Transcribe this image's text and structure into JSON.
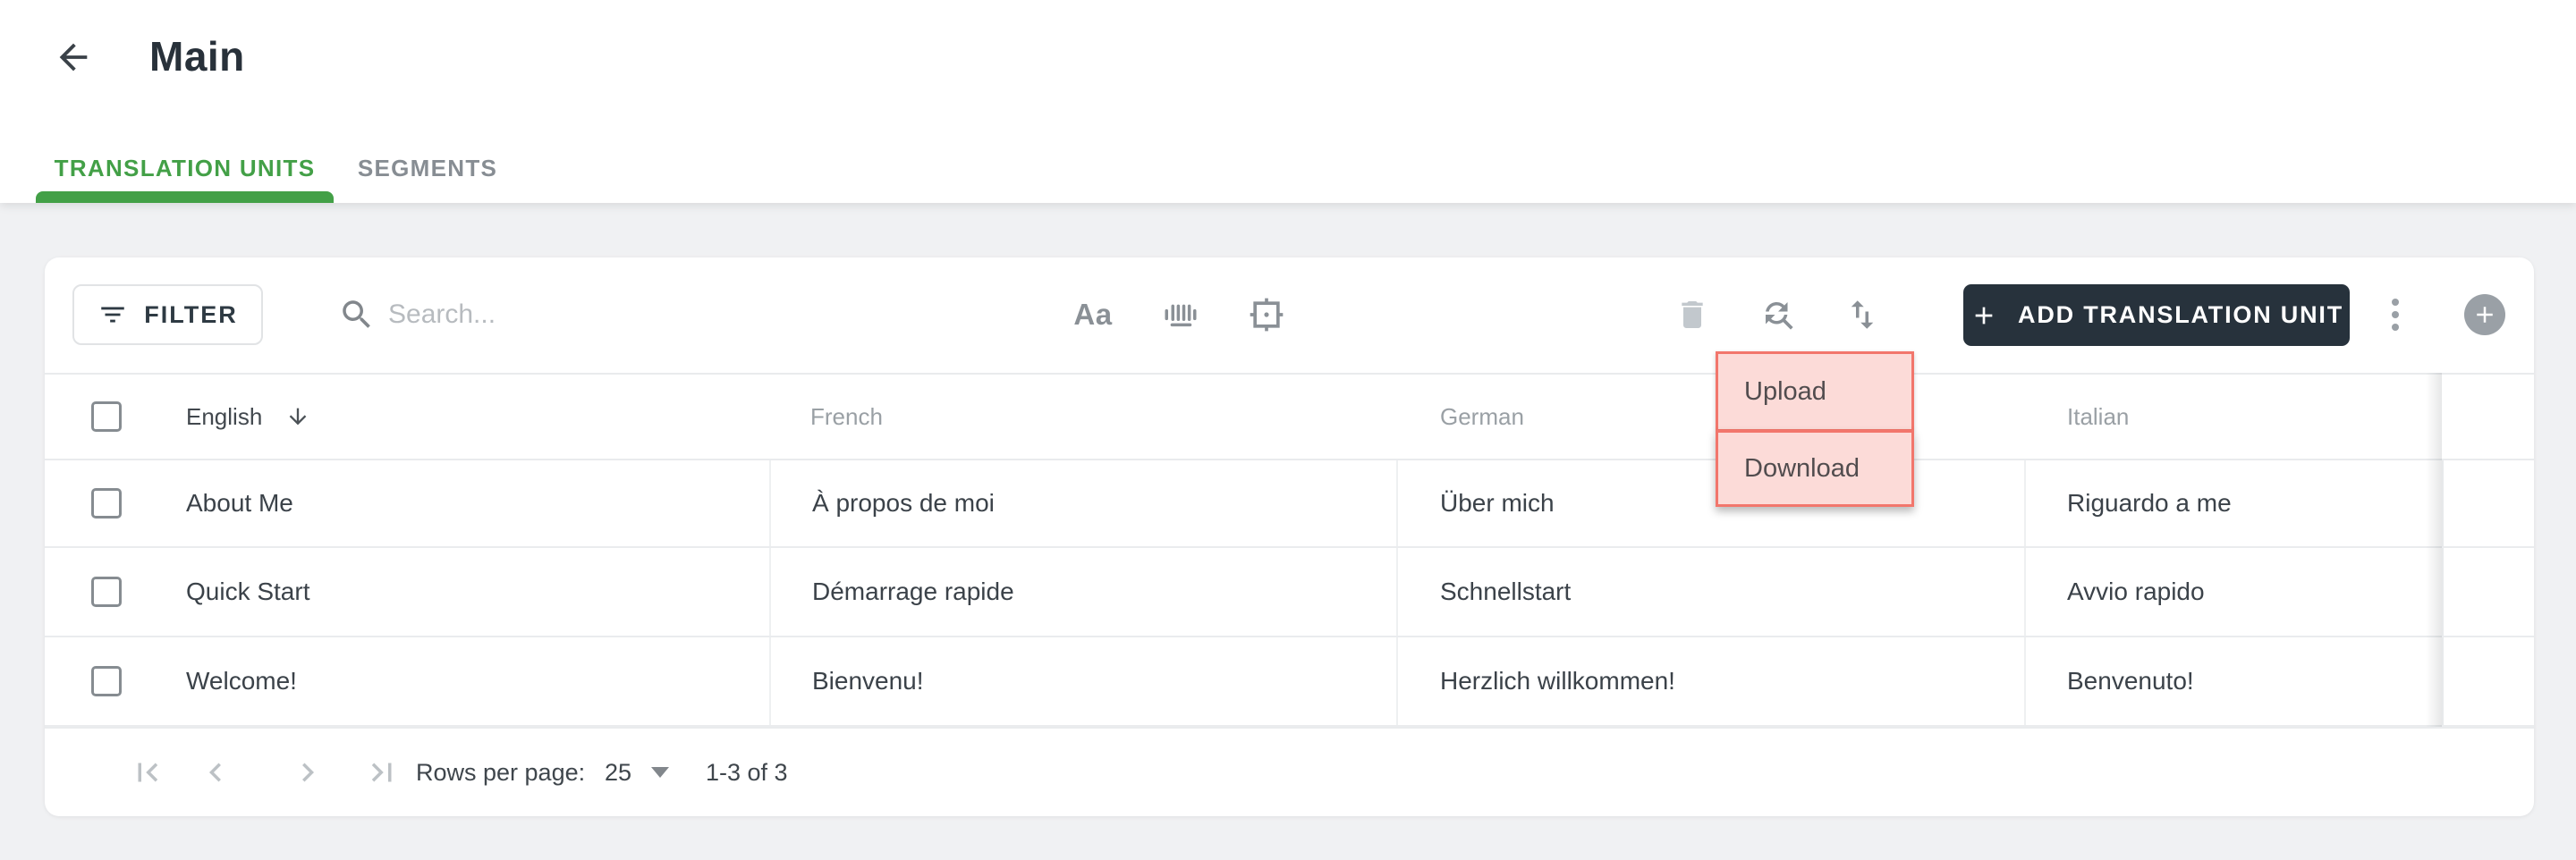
{
  "page": {
    "title": "Main"
  },
  "tabs": [
    {
      "label": "TRANSLATION UNITS",
      "active": true
    },
    {
      "label": "SEGMENTS",
      "active": false
    }
  ],
  "toolbar": {
    "filter_label": "FILTER",
    "search_placeholder": "Search...",
    "match_case_label": "Aa",
    "add_unit_label": "ADD TRANSLATION UNIT"
  },
  "menu": {
    "items": [
      {
        "label": "Upload"
      },
      {
        "label": "Download"
      }
    ]
  },
  "table": {
    "columns": [
      {
        "label": "English"
      },
      {
        "label": "French"
      },
      {
        "label": "German"
      },
      {
        "label": "Italian"
      }
    ],
    "sort": {
      "column": "English",
      "direction": "descending"
    },
    "rows": [
      {
        "english": "About Me",
        "french": "À propos de moi",
        "german": "Über mich",
        "italian": "Riguardo a me"
      },
      {
        "english": "Quick Start",
        "french": "Démarrage rapide",
        "german": "Schnellstart",
        "italian": "Avvio rapido"
      },
      {
        "english": "Welcome!",
        "french": "Bienvenu!",
        "german": "Herzlich willkommen!",
        "italian": "Benvenuto!"
      }
    ]
  },
  "pagination": {
    "rows_per_page_label": "Rows per page:",
    "rows_per_page_value": "25",
    "range_label": "1-3 of 3"
  },
  "colors": {
    "accent_green": "#43a047",
    "add_button_bg": "#27323c",
    "menu_highlight_border": "#f2766c",
    "menu_highlight_fill": "#fcdbd8"
  }
}
